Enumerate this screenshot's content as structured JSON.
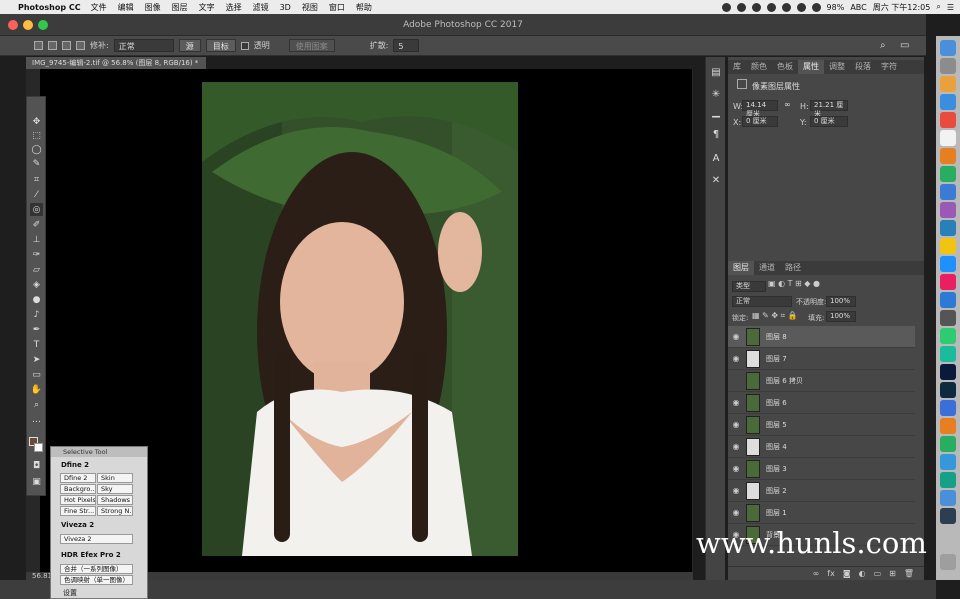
{
  "menubar": {
    "app": "Photoshop CC",
    "items": [
      "文件",
      "编辑",
      "图像",
      "图层",
      "文字",
      "选择",
      "滤镜",
      "3D",
      "视图",
      "窗口",
      "帮助"
    ],
    "battery": "98%",
    "input_method": "ABC",
    "clock": "周六 下午12:05"
  },
  "window": {
    "title": "Adobe Photoshop CC 2017"
  },
  "options": {
    "repair_label": "修补:",
    "repair_mode": "正常",
    "source": "源",
    "target": "目标",
    "transparent": "透明",
    "use_pattern": "使用图案",
    "diffuse_label": "扩散:",
    "diffuse_value": "5"
  },
  "document": {
    "tab": "IMG_9745-编辑-2.tif @ 56.8% (图层 8, RGB/16) *",
    "zoom": "56.81%"
  },
  "properties": {
    "tabs": [
      "库",
      "颜色",
      "色板",
      "属性",
      "调整",
      "段落",
      "字符"
    ],
    "active_tab": "属性",
    "section": "像素图层属性",
    "w_label": "W:",
    "w": "14.14 厘米",
    "h_label": "H:",
    "h": "21.21 厘米",
    "x_label": "X:",
    "x": "0 厘米",
    "y_label": "Y:",
    "y": "0 厘米"
  },
  "layers": {
    "tabs": [
      "图层",
      "通道",
      "路径"
    ],
    "filter": "类型",
    "blend": "正常",
    "opacity_label": "不透明度:",
    "opacity": "100%",
    "lock_label": "锁定:",
    "fill_label": "填充:",
    "fill": "100%",
    "items": [
      {
        "name": "图层 8"
      },
      {
        "name": "图层 7"
      },
      {
        "name": "图层 6 拷贝"
      },
      {
        "name": "图层 6"
      },
      {
        "name": "图层 5"
      },
      {
        "name": "图层 4"
      },
      {
        "name": "图层 3"
      },
      {
        "name": "图层 2"
      },
      {
        "name": "图层 1"
      },
      {
        "name": "背景"
      }
    ]
  },
  "selective_tool": {
    "title": "Selective Tool",
    "sections": [
      {
        "name": "Dfine 2",
        "buttons": [
          "Dfine 2",
          "Skin",
          "Backgro...",
          "Sky",
          "Hot Pixels",
          "Shadows",
          "Fine Str...",
          "Strong N..."
        ]
      },
      {
        "name": "Viveza 2",
        "buttons": [
          "Viveza 2"
        ]
      },
      {
        "name": "HDR Efex Pro 2",
        "buttons": [
          "合并（一系列图像）",
          "色调映射（单一图像）"
        ]
      }
    ],
    "settings": "设置"
  },
  "watermark": "www.hunls.com",
  "colors": {
    "accent": "#2d7ad6",
    "foreground": "#6b4a38",
    "background": "#ffffff"
  }
}
